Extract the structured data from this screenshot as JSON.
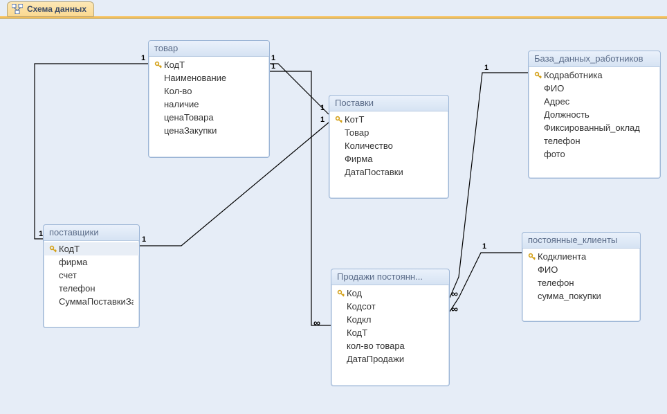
{
  "tab": {
    "title": "Схема данных"
  },
  "tables": {
    "tovar": {
      "title": "товар",
      "fields": [
        {
          "name": "КодТ",
          "pk": true
        },
        {
          "name": "Наименование",
          "pk": false
        },
        {
          "name": "Кол-во",
          "pk": false
        },
        {
          "name": "наличие",
          "pk": false
        },
        {
          "name": "ценаТовара",
          "pk": false
        },
        {
          "name": "ценаЗакупки",
          "pk": false
        }
      ]
    },
    "postavshchiki": {
      "title": "поставщики",
      "fields": [
        {
          "name": "КодТ",
          "pk": true,
          "selected": true
        },
        {
          "name": "фирма",
          "pk": false
        },
        {
          "name": "счет",
          "pk": false
        },
        {
          "name": "телефон",
          "pk": false
        },
        {
          "name": "СуммаПоставкиЗаГо",
          "pk": false
        }
      ]
    },
    "postavki": {
      "title": "Поставки",
      "fields": [
        {
          "name": "КотТ",
          "pk": true
        },
        {
          "name": "Товар",
          "pk": false
        },
        {
          "name": "Количество",
          "pk": false
        },
        {
          "name": "Фирма",
          "pk": false
        },
        {
          "name": "ДатаПоставки",
          "pk": false
        }
      ]
    },
    "prodazhi": {
      "title": "Продажи постоянн...",
      "fields": [
        {
          "name": "Код",
          "pk": true
        },
        {
          "name": "Кодсот",
          "pk": false
        },
        {
          "name": "Кодкл",
          "pk": false
        },
        {
          "name": "КодТ",
          "pk": false
        },
        {
          "name": "кол-во товара",
          "pk": false
        },
        {
          "name": "ДатаПродажи",
          "pk": false
        }
      ]
    },
    "baza_rabotnikov": {
      "title": "База_данных_работников",
      "fields": [
        {
          "name": "Кодработника",
          "pk": true
        },
        {
          "name": "ФИО",
          "pk": false
        },
        {
          "name": "Адрес",
          "pk": false
        },
        {
          "name": "Должность",
          "pk": false
        },
        {
          "name": "Фиксированный_оклад",
          "pk": false
        },
        {
          "name": "телефон",
          "pk": false
        },
        {
          "name": "фото",
          "pk": false
        }
      ]
    },
    "klienty": {
      "title": "постоянные_клиенты",
      "fields": [
        {
          "name": "Кодклиента",
          "pk": true
        },
        {
          "name": "ФИО",
          "pk": false
        },
        {
          "name": "телефон",
          "pk": false
        },
        {
          "name": "сумма_покупки",
          "pk": false
        }
      ]
    }
  },
  "relationships": [
    {
      "from_table": "поставщики",
      "from_field": "КодТ",
      "to_table": "товар",
      "to_field": "КодТ",
      "type": "1-1"
    },
    {
      "from_table": "товар",
      "from_field": "КодТ",
      "to_table": "Поставки",
      "to_field": "Товар",
      "type": "1-1"
    },
    {
      "from_table": "поставщики",
      "from_field": "КодТ",
      "to_table": "Поставки",
      "to_field": "Фирма",
      "type": "1-1"
    },
    {
      "from_table": "товар",
      "from_field": "КодТ",
      "to_table": "Продажи постоянн...",
      "to_field": "КодТ",
      "type": "1-∞"
    },
    {
      "from_table": "База_данных_работников",
      "from_field": "Кодработника",
      "to_table": "Продажи постоянн...",
      "to_field": "Кодсот",
      "type": "1-∞"
    },
    {
      "from_table": "постоянные_клиенты",
      "from_field": "Кодклиента",
      "to_table": "Продажи постоянн...",
      "to_field": "Кодкл",
      "type": "1-∞"
    }
  ],
  "labels": {
    "one": "1",
    "many": "∞"
  }
}
